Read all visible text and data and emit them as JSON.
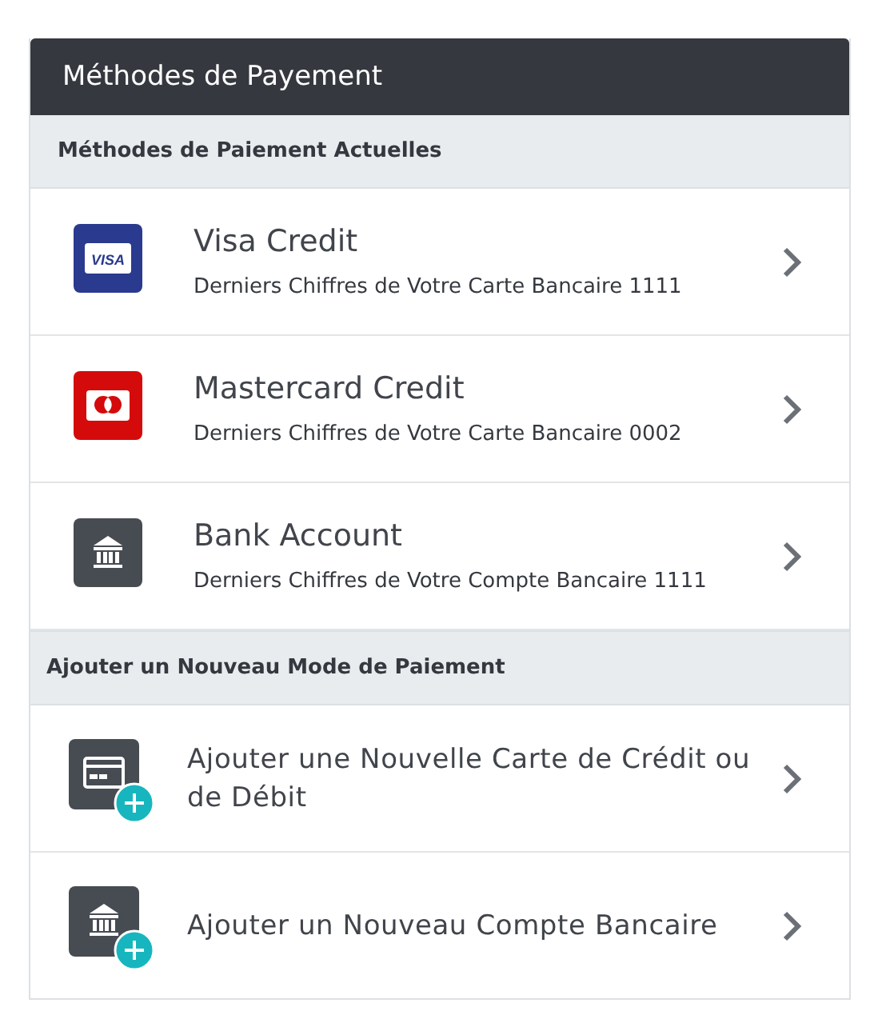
{
  "panel": {
    "title": "Méthodes de Payement"
  },
  "sections": [
    {
      "title": "Méthodes de Paiement Actuelles",
      "items": [
        {
          "kind": "visa",
          "logo_text": "VISA",
          "title": "Visa Credit",
          "subtitle": "Derniers Chiffres de Votre Carte Bancaire 1111"
        },
        {
          "kind": "mastercard",
          "title": "Mastercard Credit",
          "subtitle": "Derniers Chiffres de Votre Carte Bancaire 0002"
        },
        {
          "kind": "bank",
          "title": "Bank Account",
          "subtitle": "Derniers Chiffres de Votre Compte Bancaire 1111"
        }
      ]
    },
    {
      "title": "Ajouter un Nouveau Mode de Paiement",
      "items": [
        {
          "kind": "add-card",
          "title": "Ajouter une Nouvelle Carte de Crédit ou de Débit"
        },
        {
          "kind": "add-bank",
          "title": "Ajouter un Nouveau Compte Bancaire"
        }
      ]
    }
  ]
}
